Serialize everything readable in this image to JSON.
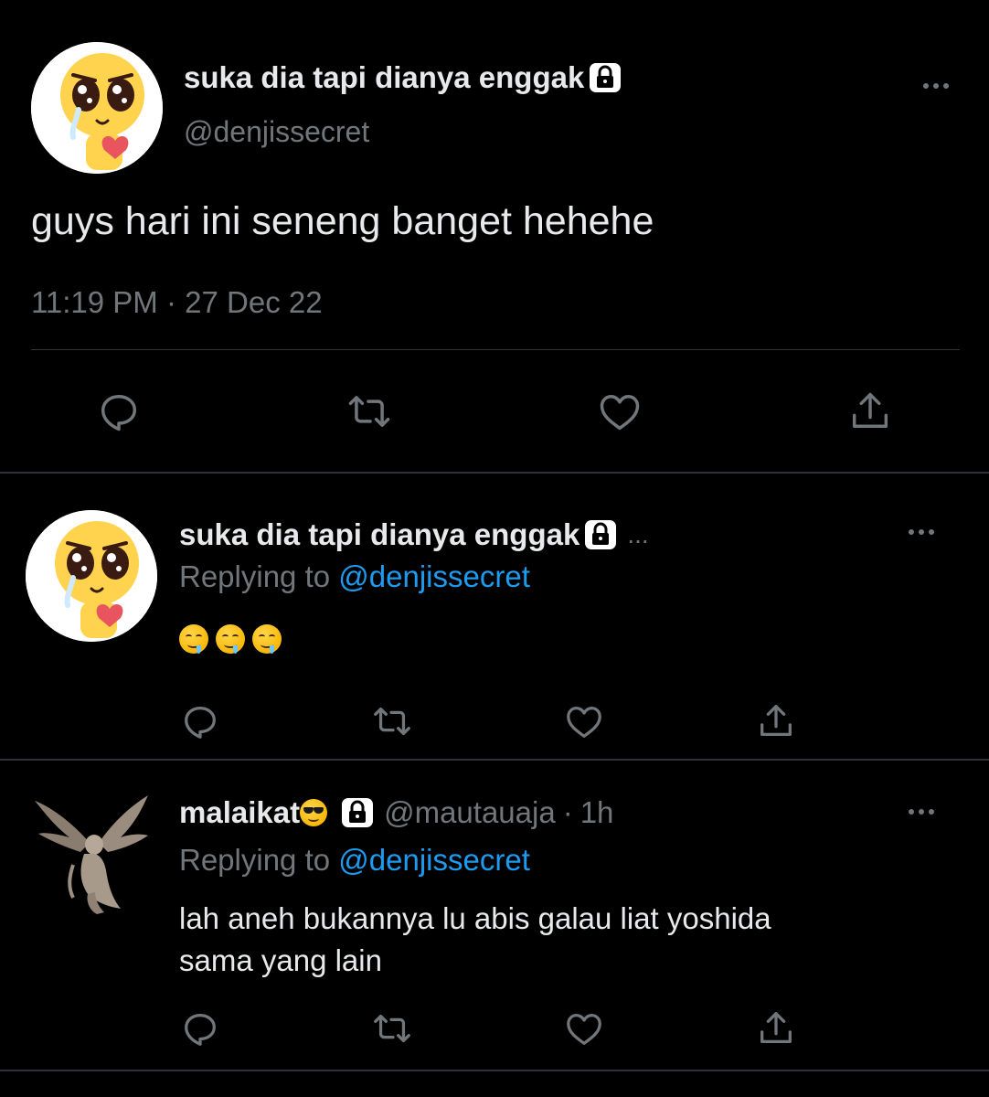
{
  "main_tweet": {
    "display_name": "suka dia tapi dianya enggak",
    "handle": "@denjissecret",
    "text": "guys hari ini seneng banget hehehe",
    "time": "11:19 PM",
    "separator": "·",
    "date": "27 Dec 22"
  },
  "reply_1": {
    "display_name": "suka dia tapi dianya enggak",
    "truncation": "...",
    "replying_prefix": "Replying to",
    "replying_handle": "@denjissecret",
    "emojis": [
      "drooling-face",
      "drooling-face",
      "drooling-face"
    ]
  },
  "reply_2": {
    "display_name": "malaikat",
    "name_emoji": "smiling-face-with-sunglasses",
    "handle": "@mautauaja",
    "separator": "·",
    "time": "1h",
    "replying_prefix": "Replying to",
    "replying_handle": "@denjissecret",
    "text_line1": "lah aneh bukannya lu abis galau liat yoshida",
    "text_line2": "sama yang lain"
  },
  "icons": {
    "reply": "reply-icon",
    "retweet": "retweet-icon",
    "like": "heart-icon",
    "share": "share-icon",
    "lock": "lock-icon",
    "more": "more-icon"
  },
  "colors": {
    "background": "#000000",
    "text": "#e7e9ea",
    "muted": "#71767b",
    "link": "#1d9bf0",
    "divider": "#2f3336"
  }
}
